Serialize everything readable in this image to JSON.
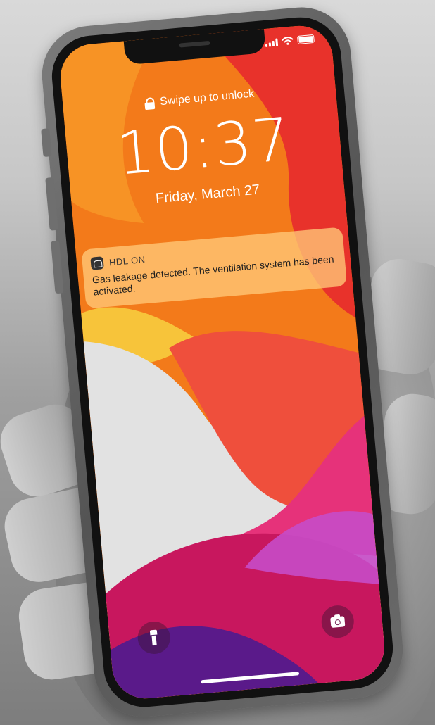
{
  "lockscreen": {
    "unlock_hint": "Swipe up to unlock",
    "time": "10:37",
    "date": "Friday, March 27"
  },
  "notification": {
    "app_name": "HDL ON",
    "app_icon": "home-icon",
    "message": "Gas leakage detected. The ventilation system has been activated."
  },
  "status_bar": {
    "icons": [
      "cellular-signal-icon",
      "wifi-icon",
      "battery-icon"
    ]
  },
  "quick_actions": {
    "left": "flashlight-icon",
    "right": "camera-icon"
  },
  "colors": {
    "wallpaper_orange": "#f37a1a",
    "wallpaper_red": "#e8322b",
    "wallpaper_magenta": "#c8175e",
    "wallpaper_purple": "#5a1a8a",
    "notification_bg": "#ffc878"
  }
}
